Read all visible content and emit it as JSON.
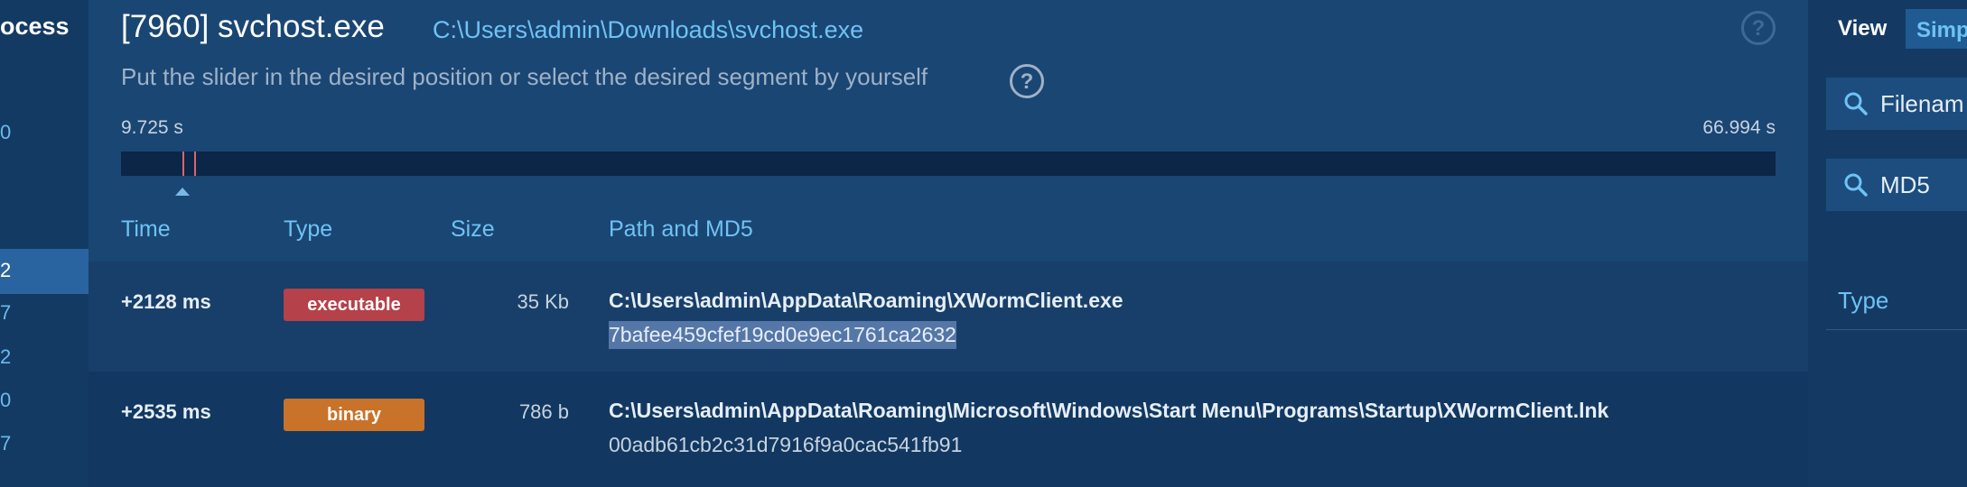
{
  "left_panel": {
    "title_fragment": "ocess",
    "numbers": [
      "0",
      "2",
      "7",
      "2",
      "0",
      "7"
    ],
    "selected_index": 1
  },
  "header": {
    "process_title": "[7960] svchost.exe",
    "process_path": "C:\\Users\\admin\\Downloads\\svchost.exe",
    "instruction": "Put the slider in the desired position or select the desired segment by yourself"
  },
  "timeline": {
    "start_label": "9.725 s",
    "end_label": "66.994 s",
    "marker_seconds": [
      11.852,
      12.259
    ],
    "slider_value_seconds": 9.725
  },
  "table": {
    "columns": [
      "Time",
      "Type",
      "Size",
      "Path and MD5"
    ],
    "rows": [
      {
        "time": "+2128 ms",
        "type": "executable",
        "type_color": "#b5414a",
        "size": "35 Kb",
        "path": "C:\\Users\\admin\\AppData\\Roaming\\XWormClient.exe",
        "md5": "7bafee459cfef19cd0e9ec1761ca2632",
        "md5_selected": true
      },
      {
        "time": "+2535 ms",
        "type": "binary",
        "type_color": "#c8722a",
        "size": "786 b",
        "path": "C:\\Users\\admin\\AppData\\Roaming\\Microsoft\\Windows\\Start Menu\\Programs\\Startup\\XWormClient.lnk",
        "md5": "00adb61cb2c31d7916f9a0cac541fb91",
        "md5_selected": false
      }
    ]
  },
  "right_panel": {
    "view_label": "View",
    "view_button": "Simp",
    "filename_field": "Filenam",
    "md5_field": "MD5",
    "type_label": "Type"
  },
  "colors": {
    "accent": "#6ec3f4",
    "marker": "#e0636b"
  },
  "icons": [
    "help-icon",
    "search-icon"
  ]
}
